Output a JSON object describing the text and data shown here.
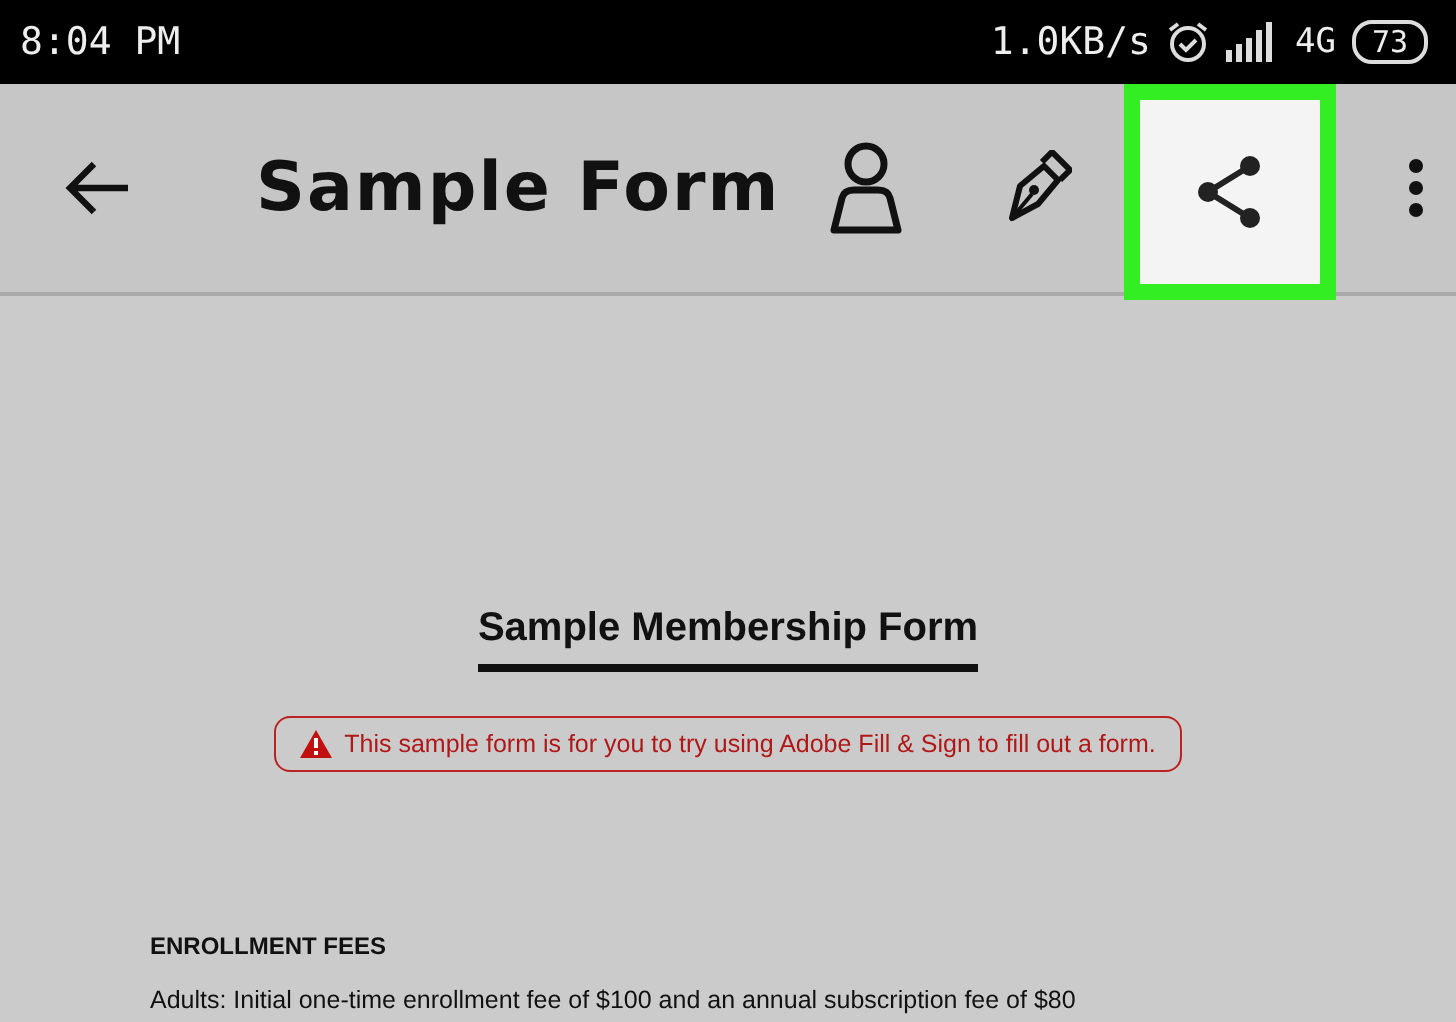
{
  "status_bar": {
    "time": "8:04 PM",
    "network_speed": "1.0KB/s",
    "network_type": "4G",
    "battery": "73"
  },
  "toolbar": {
    "title": "Sample Form",
    "actions": [
      {
        "kind": "account",
        "highlighted": false
      },
      {
        "kind": "edit",
        "highlighted": false
      },
      {
        "kind": "share",
        "highlighted": true
      },
      {
        "kind": "more",
        "highlighted": false
      }
    ]
  },
  "document": {
    "title": "Sample Membership Form",
    "notice": "This sample form is for you to try using Adobe Fill & Sign to fill out a form.",
    "section_heading": "ENROLLMENT FEES",
    "paragraph": "Adults: Initial one-time enrollment fee of $100 and an annual subscription fee of $80"
  }
}
